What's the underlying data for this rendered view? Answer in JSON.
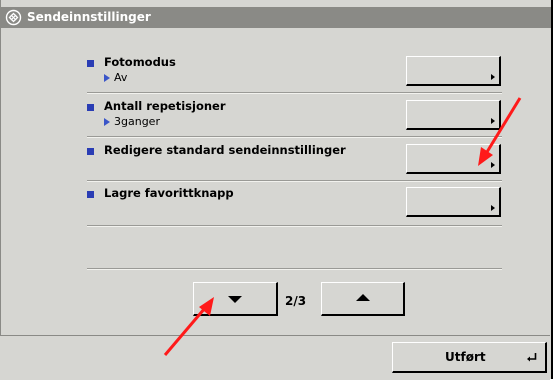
{
  "window": {
    "title": "Sendeinnstillinger",
    "title_icon": "send-settings-icon"
  },
  "settings": [
    {
      "label": "Fotomodus",
      "value": "Av"
    },
    {
      "label": "Antall repetisjoner",
      "value": "3ganger"
    },
    {
      "label": "Redigere standard sendeinnstillinger",
      "value": ""
    },
    {
      "label": "Lagre favorittknapp",
      "value": ""
    }
  ],
  "pager": {
    "indicator": "2/3",
    "down_icon": "down-triangle-icon",
    "up_icon": "up-triangle-icon"
  },
  "footer": {
    "done_label": "Utført",
    "done_icon": "enter-icon"
  },
  "annotations": {
    "arrow_color": "#ff1a1a"
  },
  "colors": {
    "panel": "#d6d6d2",
    "titlebar": "#8a8a86",
    "bullet": "#2a3db4"
  }
}
